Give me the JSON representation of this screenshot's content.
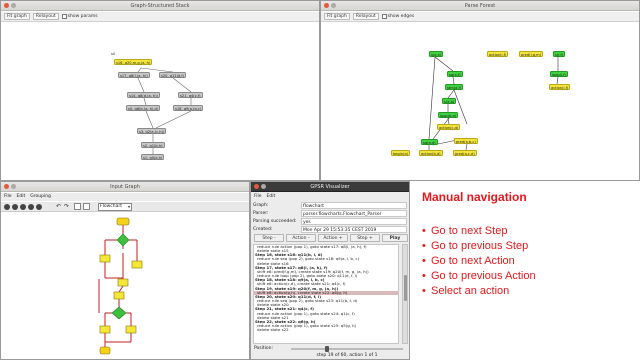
{
  "gss_window": {
    "title": "Graph-Structured Stack",
    "toolbar": {
      "fit_graph": "Fit graph",
      "relayout": "Relayout",
      "show_params": "show params"
    },
    "nodes": [
      {
        "label": "s0",
        "color": "plain"
      },
      {
        "label": "s16, q20,m,g,(a, h)",
        "color": "yellow"
      },
      {
        "label": "s17, q8(l,(a, h))",
        "color": "gray"
      },
      {
        "label": "s20, q11(d,f)",
        "color": "gray"
      },
      {
        "label": "s14, q8(d,(a, h))",
        "color": "gray"
      },
      {
        "label": "s21, q4(c,f)",
        "color": "gray"
      },
      {
        "label": "s5, q8(b,(a, h),d)",
        "color": "gray"
      },
      {
        "label": "s18, q9(a,(b,c)",
        "color": "gray"
      },
      {
        "label": "s3, q2(a,(c,h))",
        "color": "gray"
      },
      {
        "label": "s2, q1(b,h)",
        "color": "gray"
      },
      {
        "label": "s1, q0(a,h)",
        "color": "gray"
      }
    ]
  },
  "parse_forest": {
    "title": "Parse Forest",
    "toolbar": {
      "fit_graph": "Fit graph",
      "relayout": "Relayout",
      "show_edges": "show edges"
    },
    "nodes": [
      {
        "label": "s(a,h)",
        "color": "green"
      },
      {
        "label": "action(i,f)",
        "color": "yellow"
      },
      {
        "label": "pred(i,g,m)",
        "color": "yellow"
      },
      {
        "label": "s(i,f)",
        "color": "green"
      },
      {
        "label": "sq(a,f)",
        "color": "green"
      },
      {
        "label": "loop(l,f)",
        "color": "green"
      },
      {
        "label": "stm(a,f)",
        "color": "green"
      },
      {
        "label": "action(i,f)",
        "color": "yellow"
      },
      {
        "label": "s(a,b)",
        "color": "green"
      },
      {
        "label": "loop(b,d)",
        "color": "green"
      },
      {
        "label": "action(c,d)",
        "color": "yellow"
      },
      {
        "label": "sq(a,d)",
        "color": "green"
      },
      {
        "label": "pred(a,b,c)",
        "color": "yellow"
      },
      {
        "label": "begin(a)",
        "color": "yellow"
      },
      {
        "label": "action(b,d)",
        "color": "yellow"
      },
      {
        "label": "pred(a,c,d)",
        "color": "yellow"
      }
    ]
  },
  "input_graph": {
    "title": "Input Graph",
    "menu": [
      "File",
      "Edit",
      "Grouping"
    ],
    "mode_select": "Flowchart"
  },
  "visualizer": {
    "title": "GPSR Visualizer",
    "menu": [
      "File",
      "Edit"
    ],
    "fields": [
      {
        "label": "Graph:",
        "value": "flowchart"
      },
      {
        "label": "Parser:",
        "value": "parser.flowcharts.Flowchart_Parser"
      },
      {
        "label": "Parsing succeeded:",
        "value": "yes"
      },
      {
        "label": "Created:",
        "value": "Mon Apr 29 15:53:35 CEST 2019"
      }
    ],
    "buttons": {
      "step_back": "Step -",
      "action_back": "Action -",
      "action_fwd": "Action +",
      "step_fwd": "Step +",
      "play": "Play"
    },
    "log": [
      {
        "text": "reduce rule action (pop 1), goto state s17: q8(l, (a, h), f)",
        "kind": "sub"
      },
      {
        "text": "delete state s15",
        "kind": "sub"
      },
      {
        "text": "Step 16, state s16: q11(b, l, d)",
        "kind": "step"
      },
      {
        "text": "reduce rule seq (pop 2), goto state s18: q9(a, l, b, c)",
        "kind": "sub"
      },
      {
        "text": "delete state s16",
        "kind": "sub"
      },
      {
        "text": "Step 17, state s17: q8(l, (a, h), f)",
        "kind": "step"
      },
      {
        "text": "shift e6: pred(f,g,m), create state s19: q20(f, m, g, (a, h))",
        "kind": "sub"
      },
      {
        "text": "reduce rule loop (pop 2), goto state s20: q11(d, f, l)",
        "kind": "sub"
      },
      {
        "text": "Step 18, state s18: q9(a, l, b, c)",
        "kind": "step"
      },
      {
        "text": "shift e6: action(c,d), create state s21: q4(c, f)",
        "kind": "sub"
      },
      {
        "text": "Step 19, state s19: q20(f, m, g, (a, h))",
        "kind": "step"
      },
      {
        "text": "shift e8: action(g,h), create state s22: q6(g, h)",
        "kind": "hl"
      },
      {
        "text": "Step 20, state s20: q11(d, f, l)",
        "kind": "step"
      },
      {
        "text": "reduce rule seq (pop 2), goto state s23: q11(b, f, d)",
        "kind": "sub"
      },
      {
        "text": "delete state s20",
        "kind": "sub"
      },
      {
        "text": "Step 21, state s21: q4(c, f)",
        "kind": "step"
      },
      {
        "text": "reduce rule action (pop 1), goto state s24: q1(c, f)",
        "kind": "sub"
      },
      {
        "text": "delete state s21",
        "kind": "sub"
      },
      {
        "text": "Step 22, state s22: q6(g, h)",
        "kind": "step"
      },
      {
        "text": "reduce rule action (pop 1), goto state s25: q5(g, h)",
        "kind": "sub"
      },
      {
        "text": "delete state s22",
        "kind": "sub"
      }
    ],
    "position_label": "Position:",
    "status": "step 19 of 60, action 1 of 1"
  },
  "slide": {
    "heading": "Manual navigation",
    "bullets": [
      "Go to next Step",
      "Go to previous Step",
      "Go to next Action",
      "Go to previous Action",
      "Select an action"
    ]
  },
  "colors": {
    "accent": "#e4171c",
    "node_yellow": "#f5e63a",
    "node_green": "#3fd33f",
    "node_gray": "#c8c8c8"
  }
}
